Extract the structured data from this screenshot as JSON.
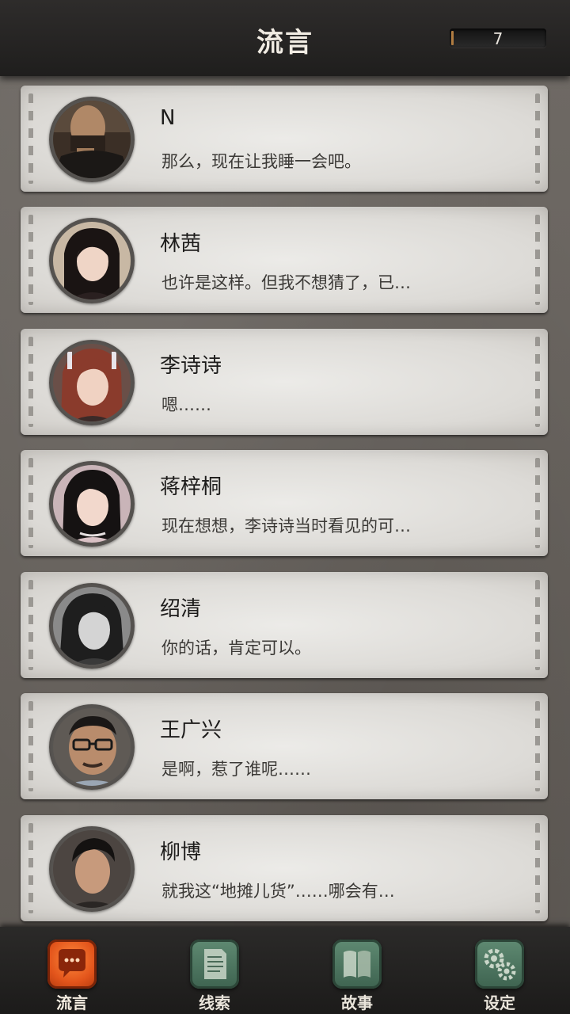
{
  "header": {
    "title": "流言",
    "counter": "7"
  },
  "contacts": [
    {
      "name": "N",
      "message": "那么，现在让我睡一会吧。"
    },
    {
      "name": "林茜",
      "message": "也许是这样。但我不想猜了，已…"
    },
    {
      "name": "李诗诗",
      "message": "嗯……"
    },
    {
      "name": "蒋梓桐",
      "message": "现在想想，李诗诗当时看见的可…"
    },
    {
      "name": "绍清",
      "message": "你的话，肯定可以。"
    },
    {
      "name": "王广兴",
      "message": "是啊，惹了谁呢……"
    },
    {
      "name": "柳博",
      "message": "就我这“地摊儿货”……哪会有…"
    }
  ],
  "nav": {
    "tabs": [
      {
        "label": "流言",
        "icon": "chat-bubble-icon",
        "active": true
      },
      {
        "label": "线索",
        "icon": "document-icon",
        "active": false
      },
      {
        "label": "故事",
        "icon": "book-icon",
        "active": false
      },
      {
        "label": "设定",
        "icon": "gear-icon",
        "active": false
      }
    ]
  },
  "colors": {
    "active_tab": "#e2541b",
    "inactive_tab": "#4f7a62",
    "header_bg": "#262524"
  }
}
